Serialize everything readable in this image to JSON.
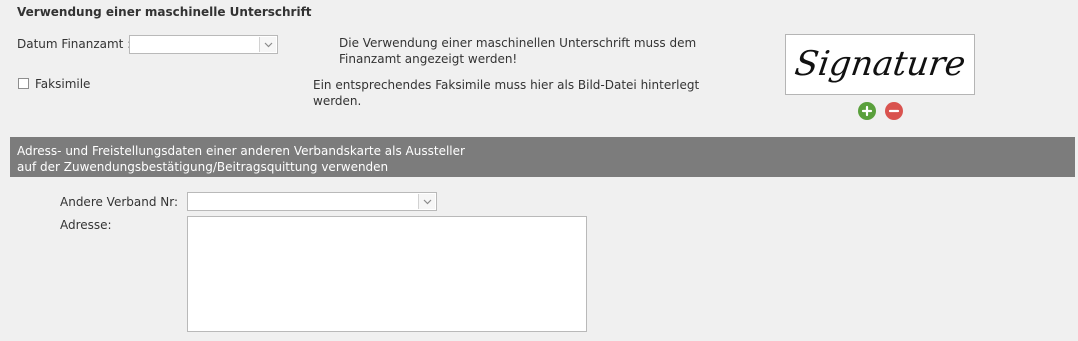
{
  "section": {
    "title": "Verwendung einer maschinelle Unterschrift"
  },
  "datum": {
    "label": "Datum Finanzamt :",
    "value": ""
  },
  "info_text_1": {
    "line1": "Die Verwendung einer maschinellen Unterschrift muss dem",
    "line2": "Finanzamt angezeigt werden!"
  },
  "faksimile": {
    "label": "Faksimile",
    "checked": false
  },
  "info_text_2": {
    "line1": "Ein entsprechendes Faksimile muss hier als Bild-Datei hinterlegt",
    "line2": "werden."
  },
  "signature": {
    "image_text": "Signature",
    "add_icon": "plus-circle-icon",
    "remove_icon": "minus-circle-icon",
    "add_color": "#5aa03c",
    "remove_color": "#d9534f"
  },
  "banner": {
    "line1": "Adress- und Freistellungsdaten einer anderen Verbandskarte als Aussteller",
    "line2": "auf der Zuwendungsbestätigung/Beitragsquittung verwenden",
    "background": "#7c7c7c"
  },
  "verband": {
    "label": "Andere Verband Nr:",
    "value": ""
  },
  "adresse": {
    "label": "Adresse:",
    "value": ""
  }
}
